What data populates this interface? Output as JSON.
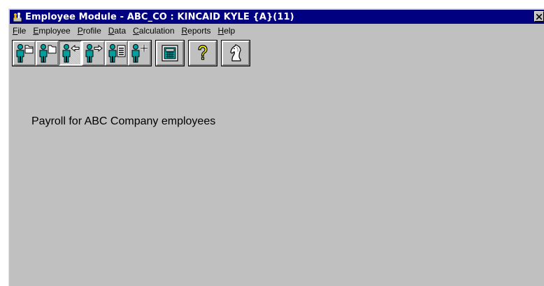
{
  "window": {
    "title": "Employee Module - ABC_CO : KINCAID KYLE {A}(11)",
    "close_label": "×"
  },
  "menubar": {
    "items": [
      {
        "label": "File",
        "accel": "F",
        "rest": "ile"
      },
      {
        "label": "Employee",
        "accel": "E",
        "rest": "mployee"
      },
      {
        "label": "Profile",
        "accel": "P",
        "rest": "rofile"
      },
      {
        "label": "Data",
        "accel": "D",
        "rest": "ata"
      },
      {
        "label": "Calculation",
        "accel": "C",
        "rest": "alculation"
      },
      {
        "label": "Reports",
        "accel": "R",
        "rest": "eports"
      },
      {
        "label": "Help",
        "accel": "H",
        "rest": "elp"
      }
    ]
  },
  "toolbar": {
    "buttons": [
      {
        "icon": "employee-open-folder-icon",
        "pressed": false
      },
      {
        "icon": "employee-close-folder-icon",
        "pressed": false
      },
      {
        "icon": "employee-previous-icon",
        "pressed": true
      },
      {
        "icon": "employee-next-icon",
        "pressed": false
      },
      {
        "icon": "employee-list-icon",
        "pressed": false
      },
      {
        "icon": "employee-add-icon",
        "pressed": false
      },
      {
        "icon": "calculator-icon",
        "pressed": false
      },
      {
        "icon": "help-question-icon",
        "pressed": false
      },
      {
        "icon": "chess-knight-icon",
        "pressed": false
      }
    ]
  },
  "main": {
    "description": "Payroll for ABC Company employees"
  },
  "colors": {
    "titlebar": "#000080",
    "face": "#c0c0c0",
    "icon_teal": "#00a0a0",
    "help_yellow": "#ffff00"
  }
}
